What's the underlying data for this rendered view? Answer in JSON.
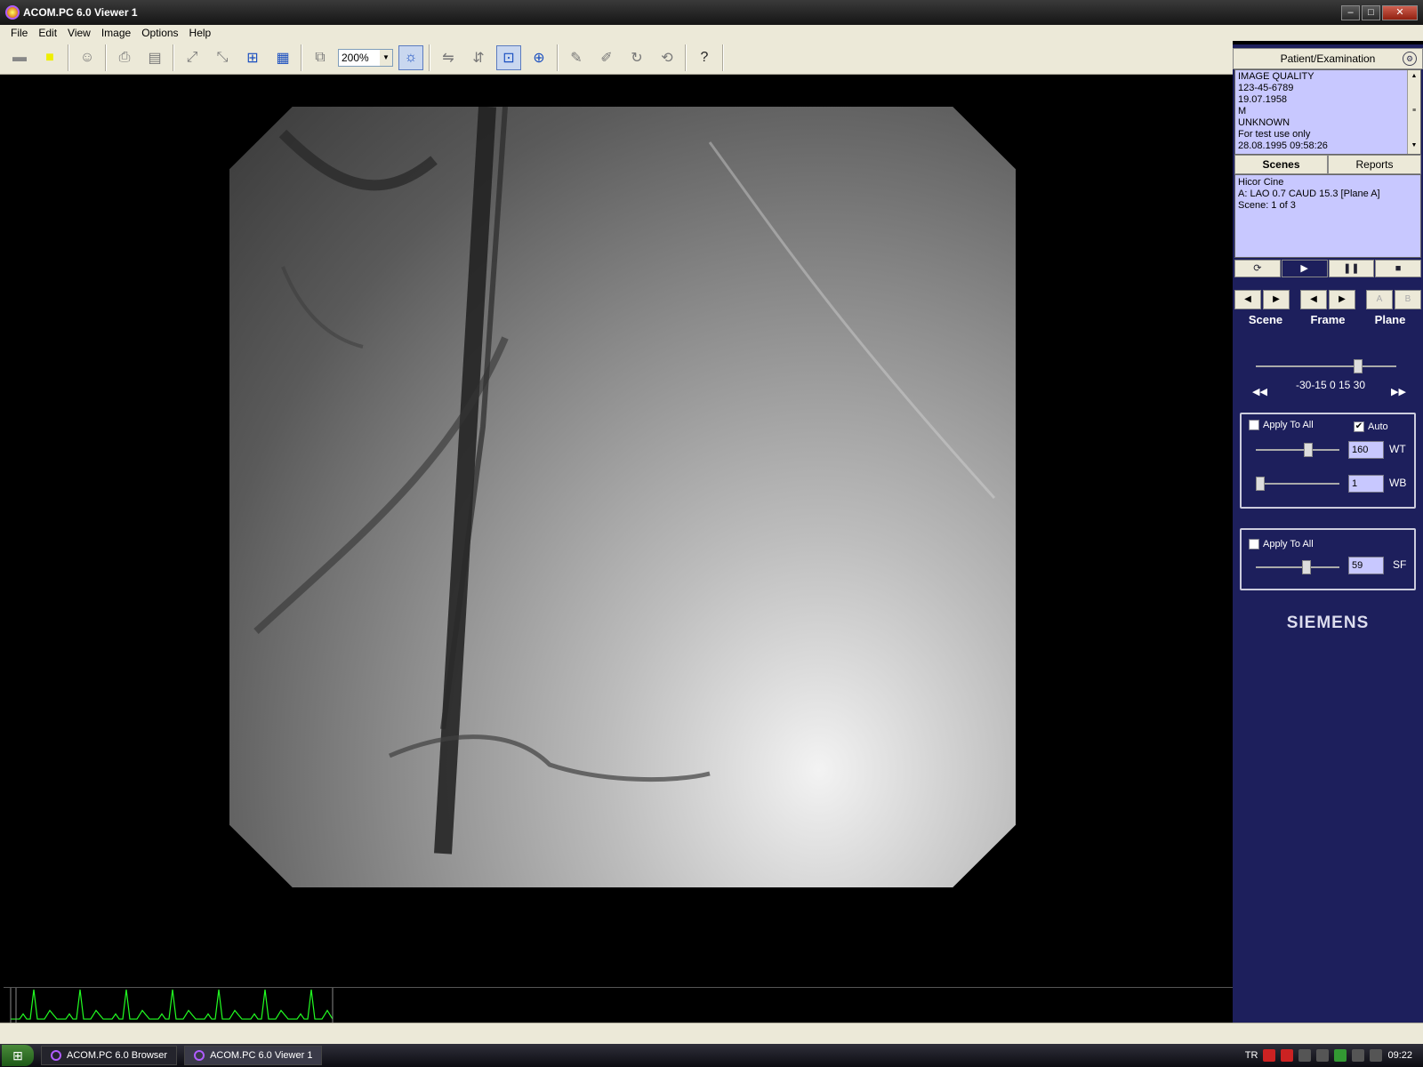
{
  "window": {
    "title": "ACOM.PC 6.0 Viewer 1",
    "controls": [
      "‒",
      "□",
      "✕"
    ]
  },
  "menu": [
    "File",
    "Edit",
    "View",
    "Image",
    "Options",
    "Help"
  ],
  "toolbar": {
    "zoom": "200%"
  },
  "patient": {
    "header": "Patient/Examination",
    "lines": [
      "IMAGE QUALITY",
      "123-45-6789",
      "19.07.1958",
      "M",
      "UNKNOWN",
      "For test use only",
      "28.08.1995  09:58:26"
    ]
  },
  "tabs": {
    "scenes": "Scenes",
    "reports": "Reports"
  },
  "scene": {
    "lines": [
      "Hicor Cine",
      "A: LAO 0.7 CAUD 15.3  [Plane A]",
      "Scene: 1 of 3"
    ]
  },
  "nav": {
    "scene": "Scene",
    "frame": "Frame",
    "plane": "Plane",
    "plane_a": "A",
    "plane_b": "B"
  },
  "speed": {
    "ticks": "-30-15  0  15 30",
    "value": 30
  },
  "window_level": {
    "apply_all": "Apply To All",
    "auto": "Auto",
    "auto_checked": true,
    "wt_value": "160",
    "wt_label": "WT",
    "wb_value": "1",
    "wb_label": "WB"
  },
  "sharpen": {
    "apply_all": "Apply To All",
    "sf_value": "59",
    "sf_label": "SF"
  },
  "brand": "SIEMENS",
  "taskbar": {
    "tasks": [
      "ACOM.PC 6.0 Browser",
      "ACOM.PC 6.0 Viewer 1"
    ],
    "lang": "TR",
    "clock": "09:22"
  },
  "colors": {
    "panel_bg": "#1d1f5c",
    "info_bg": "#c8c8ff",
    "ecg_trace": "#22ff22"
  }
}
